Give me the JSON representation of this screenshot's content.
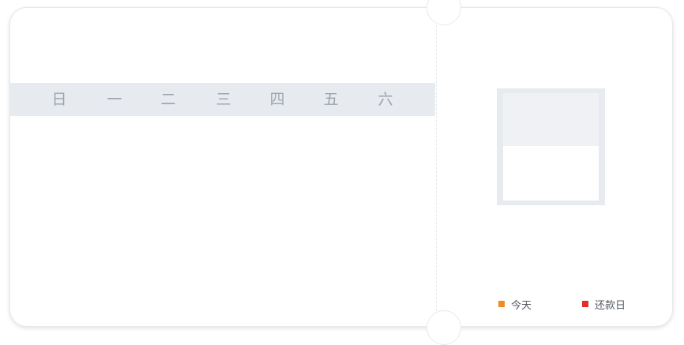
{
  "calendar": {
    "weekdays": [
      "日",
      "一",
      "二",
      "三",
      "四",
      "五",
      "六"
    ]
  },
  "legend": {
    "today": {
      "label": "今天",
      "color": "#f08a24"
    },
    "repayment_day": {
      "label": "还款日",
      "color": "#e02e2e"
    }
  }
}
